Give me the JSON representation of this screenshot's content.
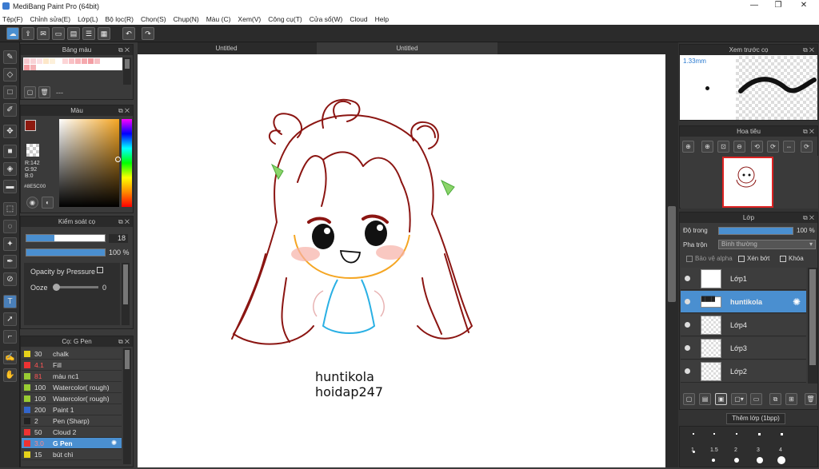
{
  "window": {
    "title": "MediBang Paint Pro (64bit)",
    "controls": [
      "—",
      "❐",
      "✕"
    ]
  },
  "menu": [
    "Tệp(F)",
    "Chỉnh sửa(E)",
    "Lớp(L)",
    "Bộ lọc(R)",
    "Chọn(S)",
    "Chụp(N)",
    "Màu (C)",
    "Xem(V)",
    "Công cụ(T)",
    "Cửa sổ(W)",
    "Cloud",
    "Help"
  ],
  "tabs": [
    "Untitled",
    "Untitled"
  ],
  "panels": {
    "palette": {
      "title": "Bảng màu",
      "status": "---"
    },
    "color": {
      "title": "Màu",
      "r": "R:142",
      "g": "G:92",
      "b": "B:0",
      "hex": "#8E5C00",
      "primary": "#8e1a10",
      "accent": "#f5a623"
    },
    "brush_control": {
      "title": "Kiểm soát cọ",
      "size": "18",
      "opacity": "100 %",
      "opacity_by_pressure": "Opacity by Pressure",
      "ooze": "Ooze",
      "ooze_value": "0"
    },
    "brush": {
      "title": "Cọ: G Pen",
      "items": [
        {
          "size": "30",
          "name": "chalk",
          "color": "#e6d21a",
          "selected": false
        },
        {
          "size": "4.1",
          "name": "Fill",
          "color": "#e33",
          "selected": false
        },
        {
          "size": "81",
          "name": "màu nc1",
          "color": "#9c3",
          "selected": false
        },
        {
          "size": "100",
          "name": "Watercolor( rough)",
          "color": "#9c3",
          "selected": false
        },
        {
          "size": "100",
          "name": "Watercolor( rough)",
          "color": "#9c3",
          "selected": false
        },
        {
          "size": "200",
          "name": "Paint 1",
          "color": "#36c",
          "selected": false
        },
        {
          "size": "2",
          "name": "Pen (Sharp)",
          "color": "#222",
          "selected": false
        },
        {
          "size": "50",
          "name": "Cloud 2",
          "color": "#e33",
          "selected": false
        },
        {
          "size": "3.0",
          "name": "G Pen",
          "color": "#e33",
          "selected": true
        },
        {
          "size": "15",
          "name": "bút chì",
          "color": "#e6d21a",
          "selected": false
        }
      ]
    },
    "preview": {
      "title": "Xem trước cọ",
      "size": "1.33mm"
    },
    "navigator": {
      "title": "Hoa tiêu"
    },
    "layer": {
      "title": "Lớp",
      "opacity_label": "Độ trong",
      "opacity": "100 %",
      "blend_label": "Pha trộn",
      "blend": "Bình thường",
      "protect_alpha": "Bảo vệ alpha",
      "clipping": "Xén bớt",
      "lock": "Khóa",
      "items": [
        {
          "name": "Lớp1",
          "selected": false
        },
        {
          "name": "huntikola",
          "selected": true
        },
        {
          "name": "Lớp4",
          "selected": false
        },
        {
          "name": "Lớp3",
          "selected": false
        },
        {
          "name": "Lớp2",
          "selected": false
        }
      ],
      "tooltip": "Thêm lớp (1bpp)"
    },
    "brush_sizes": [
      "1",
      "1.5",
      "2",
      "3",
      "4"
    ]
  },
  "canvas_text": {
    "line1": "huntikola",
    "line2": "hoidap247"
  }
}
